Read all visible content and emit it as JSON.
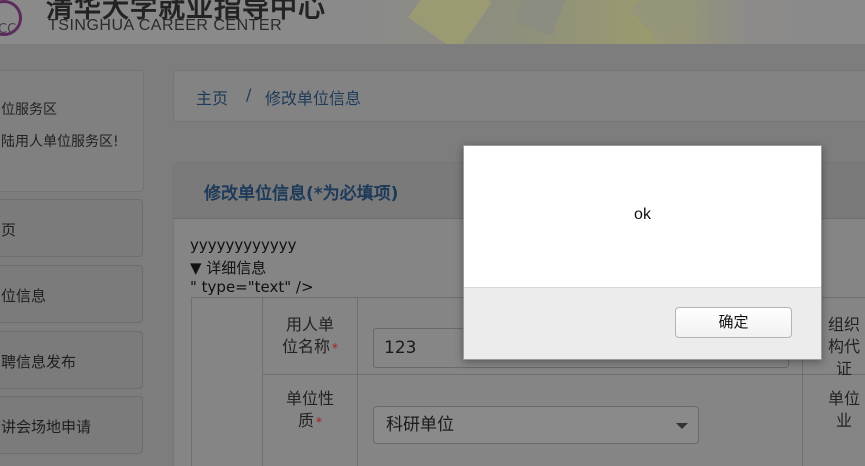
{
  "header": {
    "logo_abbr": "CC",
    "title_cn": "清华大学就业指导中心",
    "title_en": "TSINGHUA CAREER CENTER"
  },
  "sidebar": {
    "title": "位服务区",
    "welcome": "陆用人单位服务区!",
    "items": [
      {
        "label": "页"
      },
      {
        "label": "位信息"
      },
      {
        "label": "聘信息发布"
      },
      {
        "label": "讲会场地申请"
      }
    ]
  },
  "breadcrumb": {
    "home": "主页",
    "separator": "/",
    "current": "修改单位信息"
  },
  "panel": {
    "title": "修改单位信息(*为必填项)",
    "raw_line1": "yyyyyyyyyyyy",
    "raw_line2": "▼ 详细信息",
    "raw_line3": "\" type=\"text\" />"
  },
  "form": {
    "row1": {
      "label_l1": "用人单",
      "label_l2": "位名称",
      "required": "*",
      "value": "123",
      "right_label_l1": "组织",
      "right_label_l2": "构代",
      "right_label_l3": "证"
    },
    "row2": {
      "label_l1": "单位性",
      "label_l2": "质",
      "required": "*",
      "selected": "科研单位",
      "right_label_l1": "单位",
      "right_label_l2": "业"
    }
  },
  "dialog": {
    "message": "ok",
    "confirm_label": "确定"
  }
}
